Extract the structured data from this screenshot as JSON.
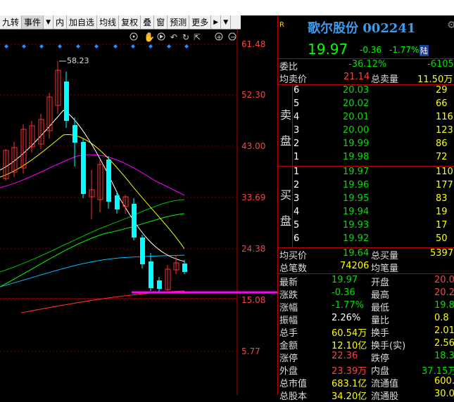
{
  "toolbar": {
    "items": [
      "九转",
      "事件",
      "内",
      "加自选",
      "均线",
      "复权",
      "叠",
      "窗",
      "预测",
      "更多"
    ]
  },
  "chart": {
    "y_labels": [
      "61.48",
      "52.30",
      "43.00",
      "33.69",
      "24.38",
      "15.08",
      "5.77"
    ],
    "peak_label": "58.23",
    "colors": {
      "up": "#ff3030",
      "down": "#00ffff",
      "ma5": "#ffffff",
      "ma10": "#ffff00",
      "ma20": "#ff00ff",
      "ma60": "#00ff00",
      "ma120": "#00c0ff",
      "ma250": "#ff3030",
      "support": "#ff00ff",
      "marker": "#1e90ff"
    }
  },
  "quote": {
    "r_tag": "R",
    "title": "歌尔股份 002241",
    "price": "19.97",
    "change": "-0.36",
    "change_pct": "-1.77%",
    "market_tag": "陆",
    "weibi_label": "委比",
    "weibi_pct": "-36.12%",
    "weibi_val": "-6105",
    "junmaijia_label": "均卖价",
    "junmaijia": "21.14",
    "zongmailiang_label": "总卖量",
    "zongmailiang": "11.50万",
    "sell_side": "卖盘",
    "sell": [
      {
        "lvl": "6",
        "price": "20.03",
        "vol": "29"
      },
      {
        "lvl": "5",
        "price": "20.02",
        "vol": "66"
      },
      {
        "lvl": "4",
        "price": "20.01",
        "vol": "116"
      },
      {
        "lvl": "3",
        "price": "20.00",
        "vol": "123"
      },
      {
        "lvl": "2",
        "price": "19.99",
        "vol": "86"
      },
      {
        "lvl": "1",
        "price": "19.98",
        "vol": "72"
      }
    ],
    "buy_side": "买盘",
    "buy": [
      {
        "lvl": "1",
        "price": "19.97",
        "vol": "110"
      },
      {
        "lvl": "2",
        "price": "19.96",
        "vol": "177"
      },
      {
        "lvl": "3",
        "price": "19.95",
        "vol": "83"
      },
      {
        "lvl": "4",
        "price": "19.94",
        "vol": "19"
      },
      {
        "lvl": "5",
        "price": "19.93",
        "vol": "17"
      },
      {
        "lvl": "6",
        "price": "19.92",
        "vol": "50"
      }
    ],
    "junmaijia2_label": "均买价",
    "junmaijia2": "19.64",
    "zongmailiang2_label": "总买量",
    "zongmailiang2": "5397",
    "zongbishu_label": "总笔数",
    "zongbishu": "74206",
    "junbiliang_label": "均笔量",
    "stats": [
      {
        "l1": "最新",
        "v1": "19.97",
        "c1": "green",
        "l2": "开盘",
        "v2": "20.0",
        "c2": "red"
      },
      {
        "l1": "涨跌",
        "v1": "-0.36",
        "c1": "green",
        "l2": "最高",
        "v2": "20.2",
        "c2": "red"
      },
      {
        "l1": "涨幅",
        "v1": "-1.77%",
        "c1": "green",
        "l2": "最低",
        "v2": "19.8",
        "c2": "green"
      },
      {
        "l1": "振幅",
        "v1": "2.26%",
        "c1": "white",
        "l2": "量比",
        "v2": "0.8",
        "c2": "yellow"
      },
      {
        "l1": "总手",
        "v1": "60.54万",
        "c1": "yellow",
        "l2": "换手",
        "v2": "2.01",
        "c2": "yellow"
      },
      {
        "l1": "金额",
        "v1": "12.10亿",
        "c1": "yellow",
        "l2": "换手(实)",
        "v2": "2.56",
        "c2": "yellow"
      },
      {
        "l1": "涨停",
        "v1": "22.36",
        "c1": "red",
        "l2": "跌停",
        "v2": "18.3",
        "c2": "green"
      },
      {
        "l1": "外盘",
        "v1": "23.39万",
        "c1": "red",
        "l2": "内盘",
        "v2": "37.15万",
        "c2": "green"
      },
      {
        "l1": "总市值",
        "v1": "683.1亿",
        "c1": "yellow",
        "l2": "流通值",
        "v2": "600.7",
        "c2": "yellow"
      },
      {
        "l1": "总股本",
        "v1": "34.20亿",
        "c1": "yellow",
        "l2": "流通股",
        "v2": "30.0",
        "c2": "yellow"
      }
    ]
  }
}
